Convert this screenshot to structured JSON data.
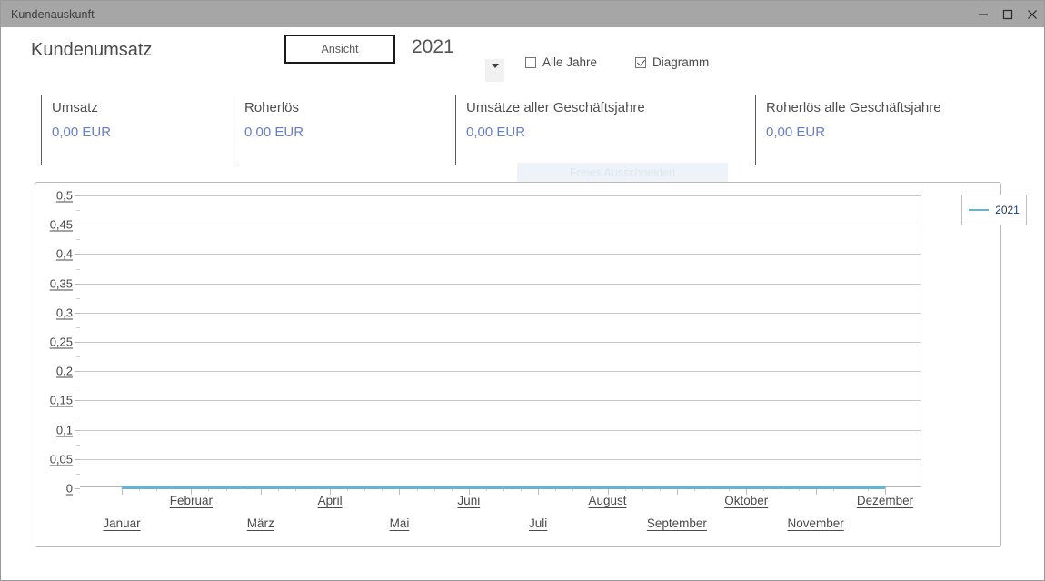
{
  "window": {
    "title": "Kundenauskunft",
    "controls": [
      {
        "name": "minimize",
        "glyph": "minimize-icon"
      },
      {
        "name": "maximize",
        "glyph": "maximize-icon"
      },
      {
        "name": "close",
        "glyph": "close-icon"
      }
    ]
  },
  "header": {
    "page_title": "Kundenumsatz",
    "view_button": "Ansicht",
    "year_value": "2021",
    "dropdown_icon": "chevron-down-icon",
    "checkboxes": [
      {
        "label": "Alle Jahre",
        "checked": false
      },
      {
        "label": "Diagramm",
        "checked": true
      }
    ]
  },
  "kpis": [
    {
      "label": "Umsatz",
      "value": "0,00 EUR"
    },
    {
      "label": "Roherlös",
      "value": "0,00 EUR"
    },
    {
      "label": "Umsätze aller Geschäftsjahre",
      "value": "0,00 EUR"
    },
    {
      "label": "Roherlös alle Geschäftsjahre",
      "value": "0,00 EUR"
    }
  ],
  "overlay": {
    "snip_tooltip": "Freies Ausschneiden"
  },
  "colors": {
    "series": "#6bb3cc",
    "kpi_value": "#6a7fbf",
    "legend_text": "#1f3864",
    "titlebar": "#a6a6a6",
    "grid": "#c9c9c9"
  },
  "chart_data": {
    "type": "line",
    "title": "",
    "xlabel": "",
    "ylabel": "",
    "categories": [
      "Januar",
      "Februar",
      "März",
      "April",
      "Mai",
      "Juni",
      "Juli",
      "August",
      "September",
      "Oktober",
      "November",
      "Dezember"
    ],
    "series": [
      {
        "name": "2021",
        "color": "#6bb3cc",
        "values": [
          0,
          0,
          0,
          0,
          0,
          0,
          0,
          0,
          0,
          0,
          0,
          0
        ]
      }
    ],
    "ylim": [
      0,
      0.5
    ],
    "ytick_labels": [
      "0",
      "0,05",
      "0,1",
      "0,15",
      "0,2",
      "0,25",
      "0,3",
      "0,35",
      "0,4",
      "0,45",
      "0,5"
    ],
    "ytick_values": [
      0,
      0.05,
      0.1,
      0.15,
      0.2,
      0.25,
      0.3,
      0.35,
      0.4,
      0.45,
      0.5
    ],
    "grid": true,
    "grid_axis": "y",
    "legend_position": "top-right",
    "legend_entries": [
      "2021"
    ]
  }
}
